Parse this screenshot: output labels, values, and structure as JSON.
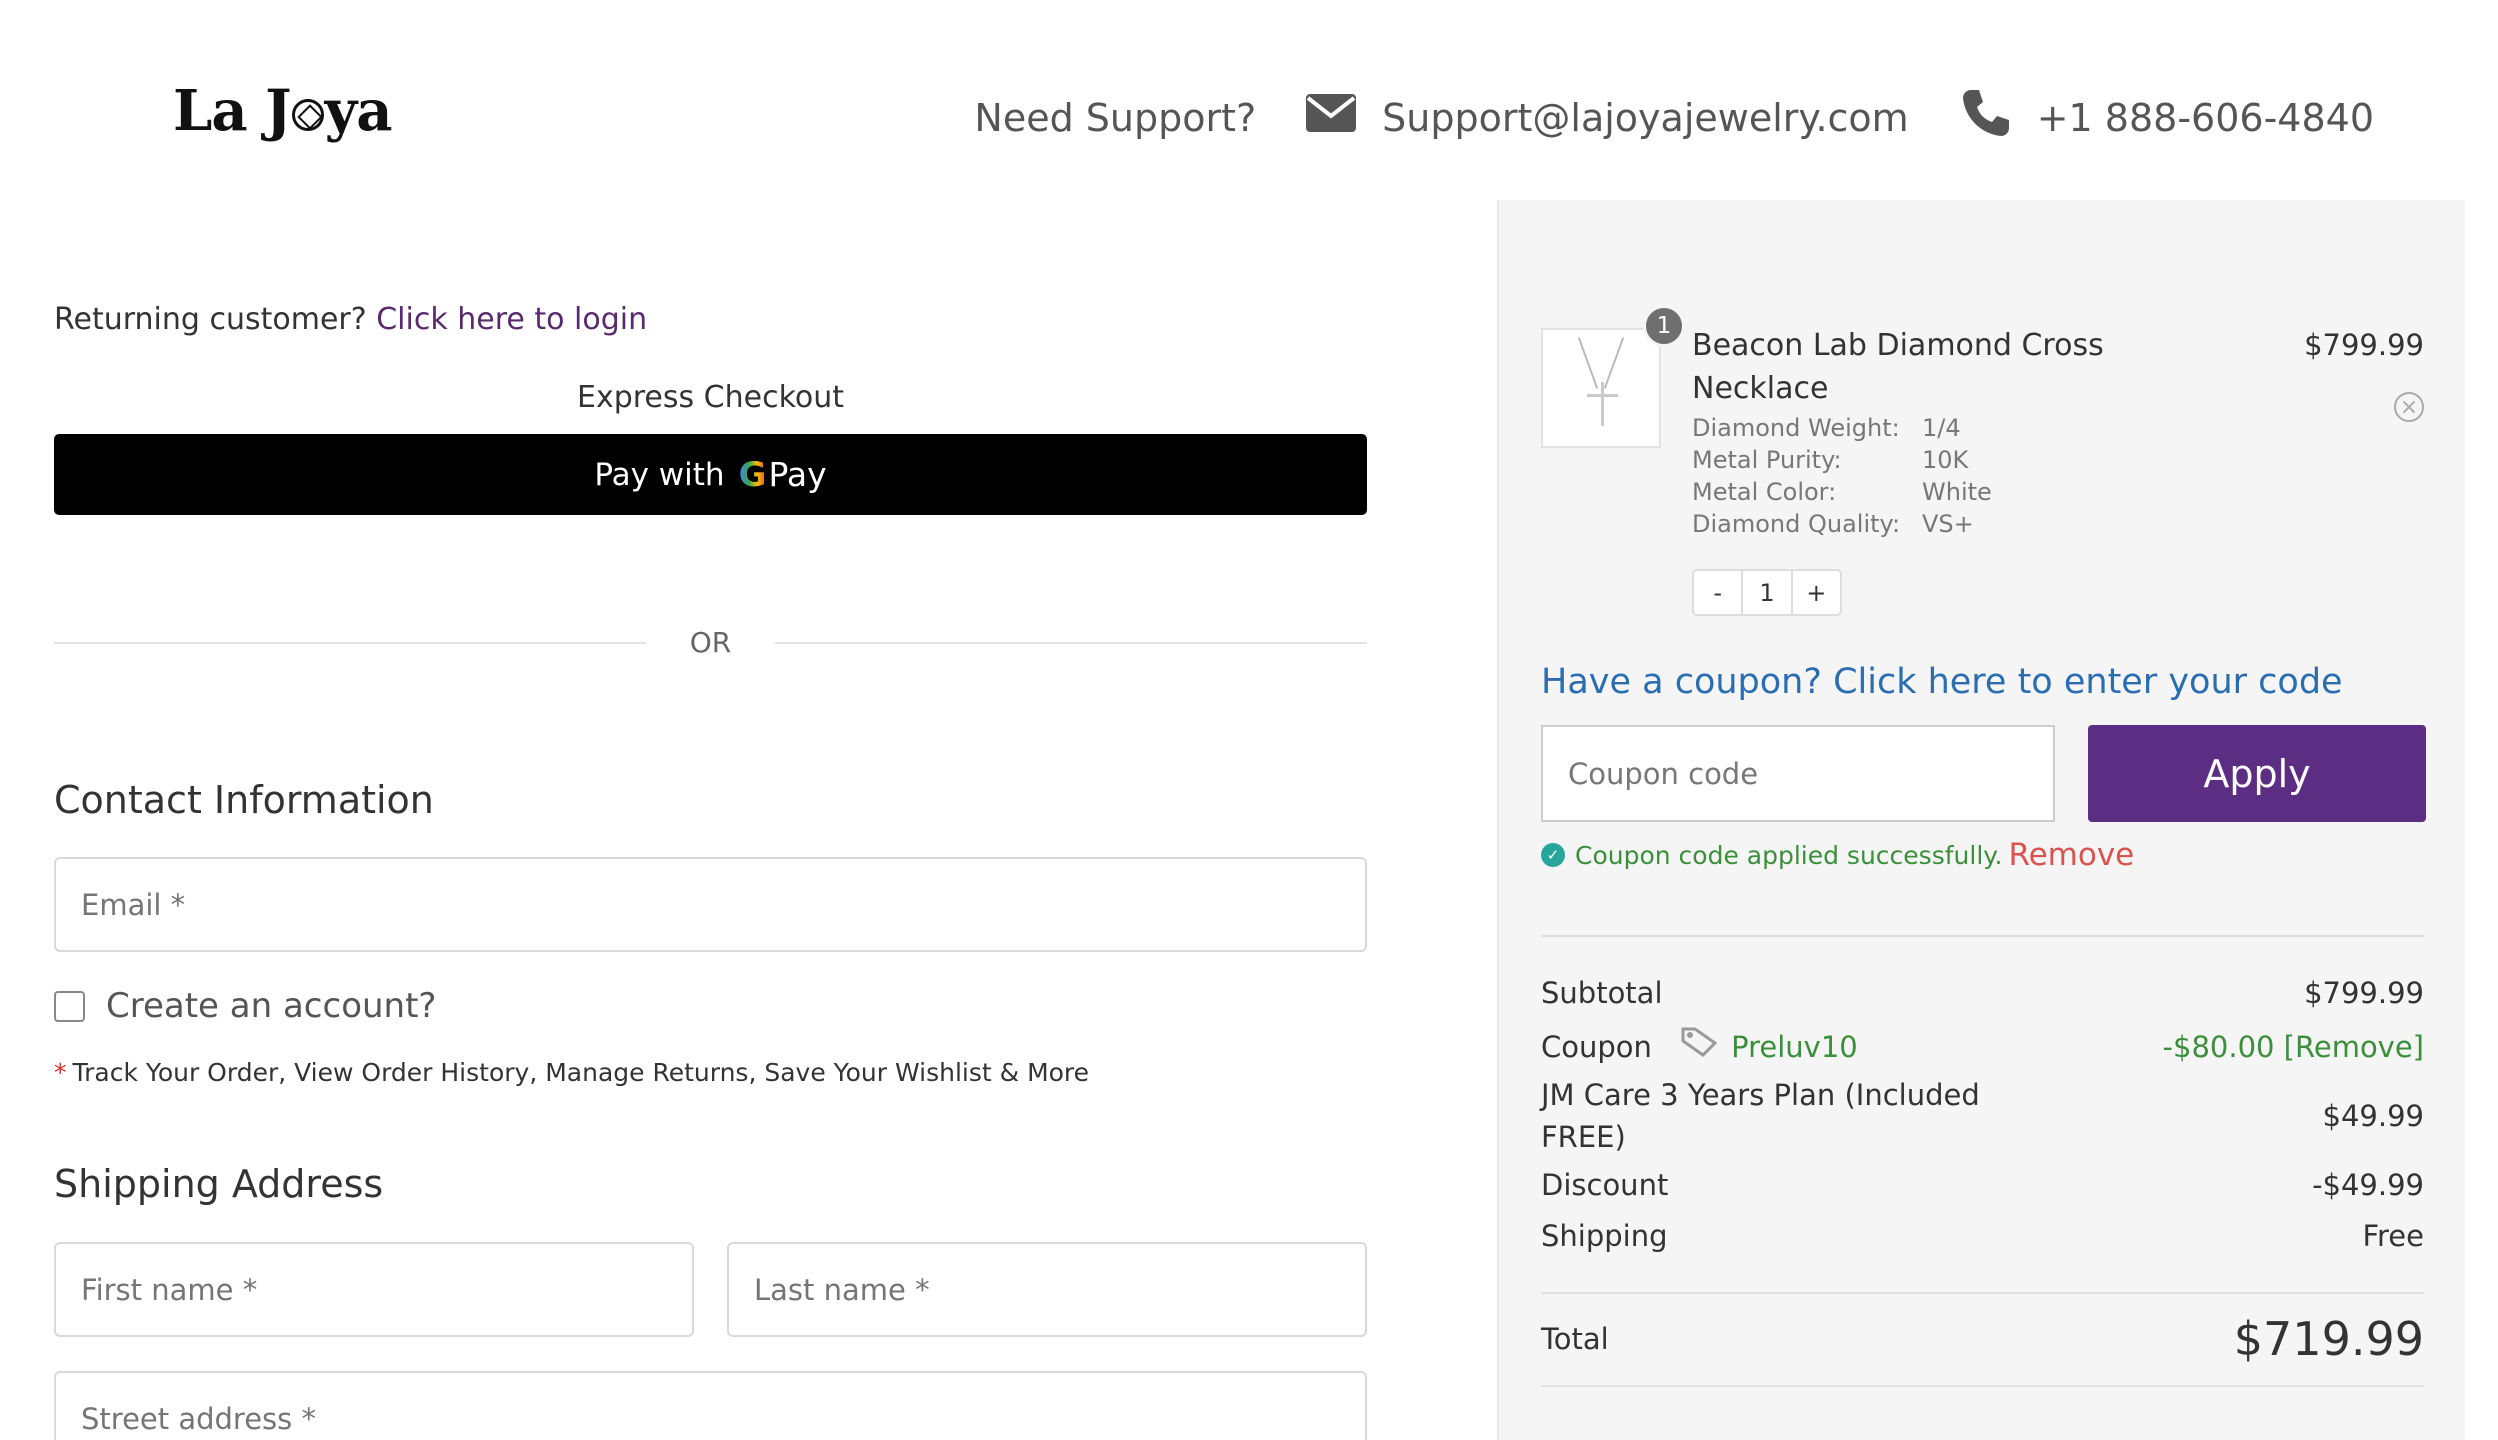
{
  "header": {
    "logo": {
      "part1": "La J",
      "part2": "ya"
    },
    "need_support": "Need Support?",
    "email": "Support@lajoyajewelry.com",
    "phone": "+1 888-606-4840"
  },
  "checkout": {
    "returning_text": "Returning customer?",
    "login_link": "Click here to login",
    "express_label": "Express Checkout",
    "gpay": {
      "prefix": "Pay with",
      "g": "G",
      "pay": "Pay"
    },
    "or": "OR",
    "contact_heading": "Contact Information",
    "email_placeholder": "Email *",
    "create_account": "Create an account?",
    "benefits_star": "*",
    "benefits": "Track Your Order, View Order History, Manage Returns, Save Your Wishlist & More",
    "shipping_heading": "Shipping Address",
    "first_name_placeholder": "First name *",
    "last_name_placeholder": "Last name *",
    "street_placeholder": "Street address *"
  },
  "cart": {
    "item": {
      "qty_badge": "1",
      "name": "Beacon Lab Diamond Cross Necklace",
      "price": "$799.99",
      "remove_icon": "×",
      "attributes": [
        {
          "k": "Diamond Weight:",
          "v": "1/4"
        },
        {
          "k": "Metal Purity:",
          "v": "10K"
        },
        {
          "k": "Metal Color:",
          "v": "White"
        },
        {
          "k": "Diamond Quality:",
          "v": "VS+"
        }
      ],
      "minus": "-",
      "quantity": "1",
      "plus": "+"
    },
    "coupon_link": "Have a coupon? Click here to enter your code",
    "coupon_placeholder": "Coupon code",
    "apply": "Apply",
    "applied_check": "✓",
    "applied_msg": "Coupon code applied successfully.",
    "applied_remove": "Remove",
    "summary": {
      "subtotal_label": "Subtotal",
      "subtotal": "$799.99",
      "coupon_label": "Coupon",
      "coupon_code": "Preluv10",
      "coupon_value": "-$80.00 [Remove]",
      "plan_label": "JM Care 3 Years Plan (Included FREE)",
      "plan_value": "$49.99",
      "discount_label": "Discount",
      "discount_value": "-$49.99",
      "shipping_label": "Shipping",
      "shipping_value": "Free",
      "total_label": "Total",
      "total_value": "$719.99"
    }
  },
  "colors": {
    "brand_purple": "#5b2d83",
    "link_blue": "#2a6db0",
    "success_green": "#3b8f3b",
    "remove_red": "#d9534f"
  },
  "icons": [
    "envelope-icon",
    "phone-icon",
    "google-g-icon",
    "close-circle-icon",
    "check-circle-icon",
    "tag-icon"
  ]
}
